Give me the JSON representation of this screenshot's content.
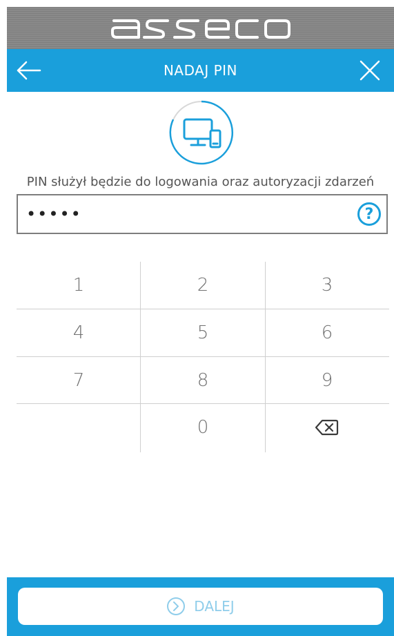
{
  "brand": {
    "logo": "asseco-logo",
    "color": "#ffffff"
  },
  "header": {
    "title": "NADAJ PIN",
    "back_icon": "arrow-left-icon",
    "close_icon": "close-icon",
    "color": "#1a9fdb"
  },
  "device_icon": "desktop-mobile-icon",
  "info_text": "PIN służył będzie do logowania oraz autoryzacji zdarzeń",
  "pin": {
    "value": "•••••",
    "help_icon": "help-icon",
    "help_label": "?"
  },
  "keypad": {
    "keys": [
      "1",
      "2",
      "3",
      "4",
      "5",
      "6",
      "7",
      "8",
      "9",
      "",
      "0",
      "⌫"
    ],
    "backspace_icon": "backspace-icon"
  },
  "footer": {
    "button_label": "DALEJ",
    "button_icon": "chevron-right-circle-icon",
    "color": "#1a9fdb"
  }
}
